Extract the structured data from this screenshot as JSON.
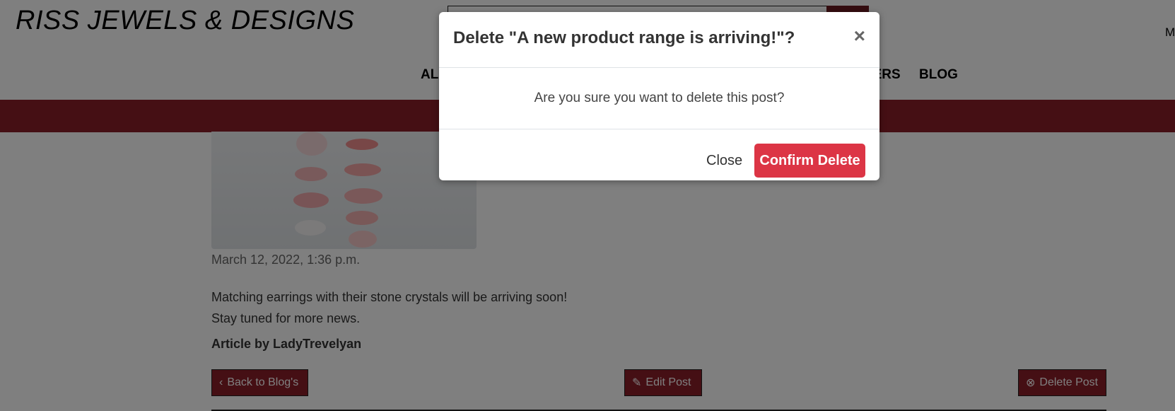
{
  "header": {
    "brand": "RISS JEWELS & DESIGNS",
    "account_fragment": "M",
    "search": {
      "placeholder": ""
    }
  },
  "nav": {
    "all_fragment": "ALL",
    "offers_fragment": "FERS",
    "blog": "BLOG"
  },
  "post": {
    "date": "March 12, 2022, 1:36 p.m.",
    "body_lines": [
      "Matching earrings with their stone crystals will be arriving soon!",
      "Stay tuned for more news."
    ],
    "author": "Article by LadyTrevelyan",
    "buttons": {
      "back": "Back to Blog's",
      "edit": "Edit Post",
      "delete": "Delete Post"
    }
  },
  "modal": {
    "title": "Delete \"A new product range is arriving!\"?",
    "close_symbol": "×",
    "message": "Are you sure you want to delete this post?",
    "close_label": "Close",
    "confirm_label": "Confirm Delete"
  },
  "colors": {
    "brand_dark": "#8b1e29",
    "danger": "#dc3545",
    "text_primary": "#333333"
  },
  "icons": {
    "search": "search-icon",
    "back": "chevron-left-icon",
    "edit": "edit-icon",
    "delete": "circle-x-icon",
    "close": "close-icon"
  }
}
